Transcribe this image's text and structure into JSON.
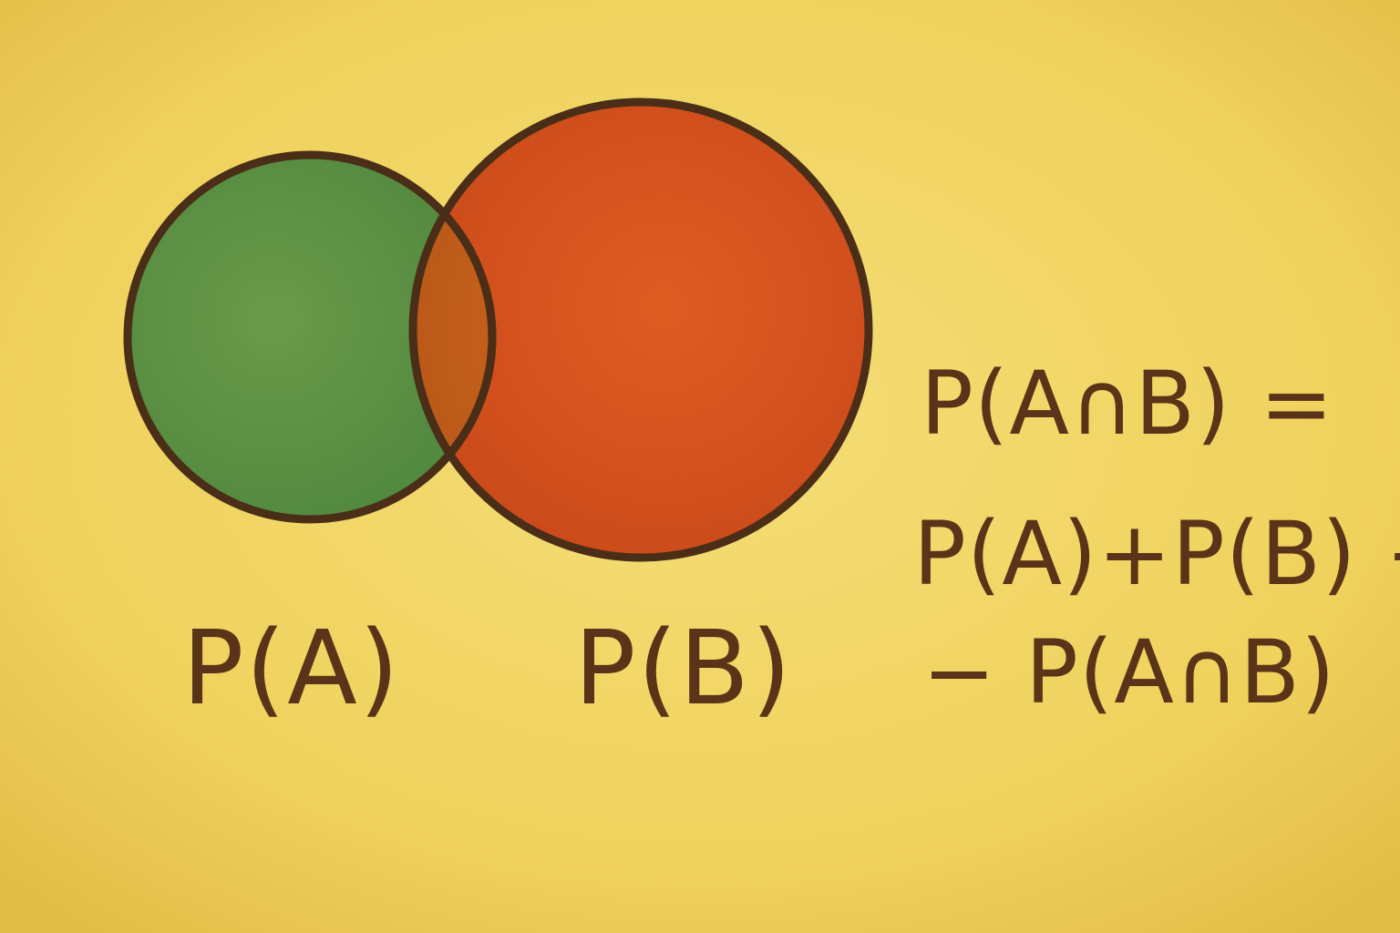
{
  "diagram": {
    "type": "venn",
    "colors": {
      "background": "#efd35f",
      "set_a": "#5f9344",
      "set_b": "#d8561f",
      "intersection": "#c8601a",
      "outline": "#4a2e17",
      "text": "#5a3418"
    },
    "labels": {
      "set_a": "P(A)",
      "set_b": "P(B)"
    },
    "formula": {
      "line1": "P(A∩B) =",
      "line2": "P(A)+P(B) −",
      "line3": "− P(A∩B)"
    }
  }
}
